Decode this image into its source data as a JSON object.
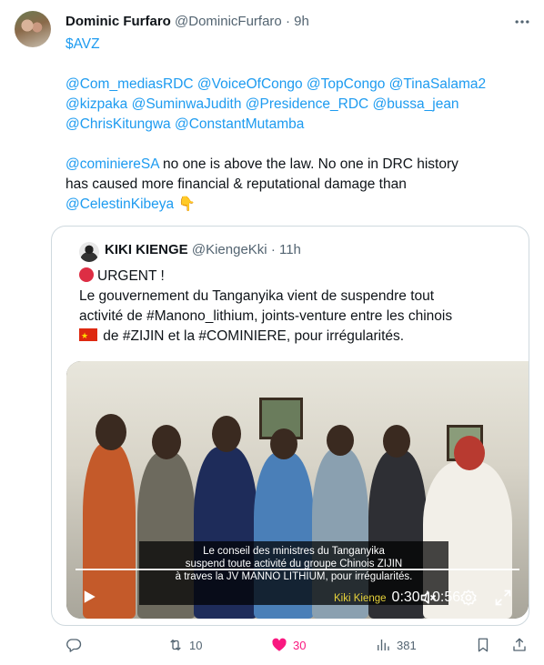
{
  "author": {
    "name": "Dominic Furfaro",
    "handle": "@DominicFurfaro",
    "separator": "·",
    "time": "9h"
  },
  "tweet": {
    "line1": "$AVZ",
    "mentions1": "@Com_mediasRDC @VoiceOfCongo @TopCongo @TinaSalama2",
    "mentions2": "@kizpaka @SuminwaJudith @Presidence_RDC @bussa_jean",
    "mentions3": "@ChrisKitungwa @ConstantMutamba",
    "mention_cominiere": "@cominiereSA",
    "text_a": " no one is above the law. No one in DRC history",
    "text_b": "has caused more financial & reputational damage than",
    "mention_celestin": "@CelestinKibeya",
    "emoji_point": "👇"
  },
  "quote": {
    "name": "KIKI KIENGE",
    "handle": "@KiengeKki",
    "separator": "·",
    "time": "11h",
    "urgent": "URGENT !",
    "line1": "Le gouvernement du Tanganyika vient de suspendre tout",
    "line2": "activité de #Manono_lithium, joints-venture entre les chinois",
    "line3": " de #ZIJIN et la #COMINIERE, pour irrégularités."
  },
  "video": {
    "subtitle1": "Le conseil des ministres du Tanganyika",
    "subtitle2": "suspend toute activité du groupe Chinois ZIJIN",
    "subtitle3": "à traves la JV MANNO LITHIUM, pour irrégularités.",
    "watermark": "Kiki Kienge",
    "time": "0:30 / 0:56",
    "progress": 0.536
  },
  "actions": {
    "retweets": "10",
    "likes": "30",
    "views": "381"
  },
  "colors": {
    "link": "#1d9bf0",
    "like": "#f91880",
    "muted": "#536471"
  },
  "icons": [
    "more-icon",
    "play-icon",
    "mute-icon",
    "settings-icon",
    "fullscreen-icon",
    "reply-icon",
    "retweet-icon",
    "like-icon",
    "views-icon",
    "bookmark-icon",
    "share-icon"
  ]
}
